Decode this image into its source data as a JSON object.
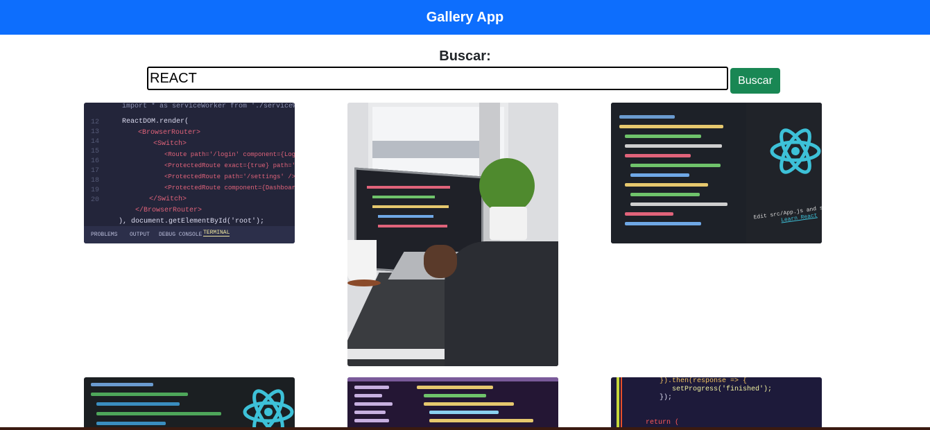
{
  "header": {
    "title": "Gallery App"
  },
  "search": {
    "label": "Buscar:",
    "value": "REACT",
    "button_label": "Buscar"
  },
  "images": {
    "img1": {
      "lines": [
        "ReactDOM.render(",
        "<BrowserRouter>",
        "<Switch>",
        "<Route path='/login' component={Login} />",
        "<ProtectedRoute exact={true} path='/' />",
        "<ProtectedRoute path='/settings' />",
        "<ProtectedRoute component={Dashboard} />",
        "</Switch>",
        "</BrowserRouter>",
        "), document.getElementById('root');"
      ],
      "top_line": "import * as serviceWorker from './serviceWorker';",
      "line_numbers": [
        "12",
        "13",
        "14",
        "15",
        "16",
        "17",
        "18",
        "19",
        "20"
      ],
      "tabs": [
        "PROBLEMS",
        "OUTPUT",
        "DEBUG CONSOLE",
        "TERMINAL"
      ]
    },
    "img3": {
      "caption": "Edit src/App.js and save to reload.",
      "link": "Learn React"
    },
    "img6": {
      "lines": [
        "}).then(response => {",
        "setProgress('finished');",
        "});",
        "return ("
      ]
    }
  }
}
